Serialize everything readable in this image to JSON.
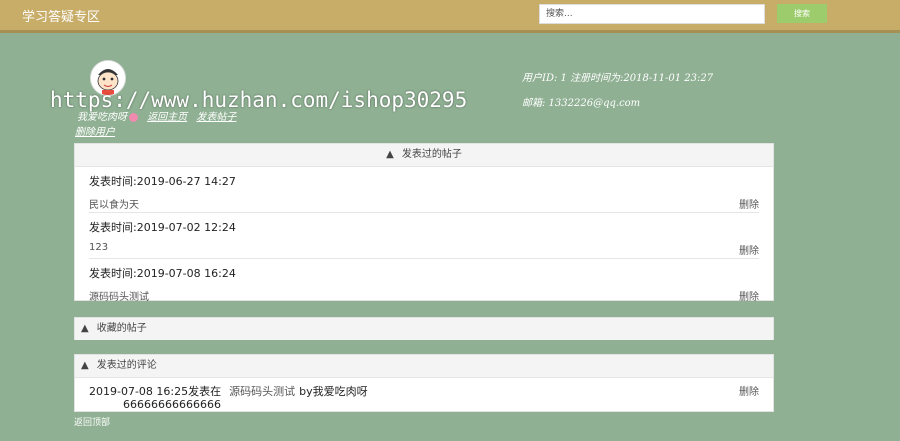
{
  "header": {
    "site_title": "学习答疑专区",
    "search_placeholder": "搜索...",
    "search_button": "搜索"
  },
  "profile": {
    "username": "我爱吃肉呀",
    "back_home": "返回主页",
    "new_post": "发表帖子",
    "delete_user": "删除用户",
    "user_info": "用户ID: 1   注册时间为:2018-11-01 23:27",
    "email": "邮箱: 1332226@qq.com"
  },
  "watermark": "https://www.huzhan.com/ishop30295",
  "posts_panel": {
    "title": "发表过的帖子",
    "items": [
      {
        "time": "发表时间:2019-06-27 14:27",
        "title": "民以食为天",
        "delete": "删除"
      },
      {
        "time": "发表时间:2019-07-02 12:24",
        "title": "123",
        "delete": "删除"
      },
      {
        "time": "发表时间:2019-07-08 16:24",
        "title": "源码码头测试",
        "delete": "删除"
      }
    ]
  },
  "favorites_panel": {
    "title": "收藏的帖子"
  },
  "comments_panel": {
    "title": "发表过的评论",
    "items": [
      {
        "prefix": "2019-07-08 16:25发表在",
        "post": "源码码头测试",
        "by": "by我爱吃肉呀",
        "text": "66666666666666",
        "delete": "删除"
      }
    ]
  },
  "footer": {
    "back_top": "返回顶部"
  }
}
